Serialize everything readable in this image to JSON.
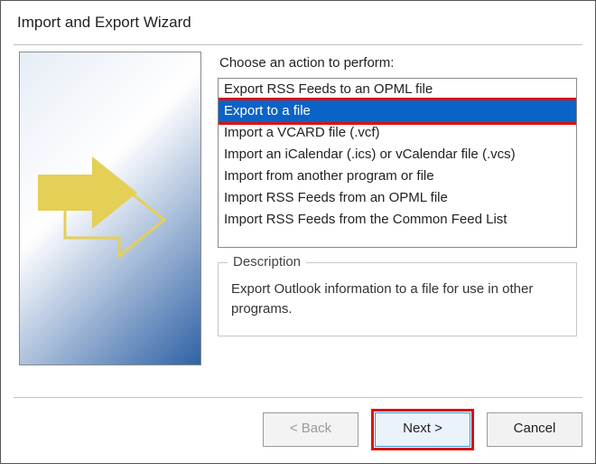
{
  "title": "Import and Export Wizard",
  "prompt": "Choose an action to perform:",
  "actions": [
    "Export RSS Feeds to an OPML file",
    "Export to a file",
    "Import a VCARD file (.vcf)",
    "Import an iCalendar (.ics) or vCalendar file (.vcs)",
    "Import from another program or file",
    "Import RSS Feeds from an OPML file",
    "Import RSS Feeds from the Common Feed List"
  ],
  "selected_index": 1,
  "highlighted_action_index": 1,
  "description": {
    "legend": "Description",
    "text": "Export Outlook information to a file for use in other programs."
  },
  "buttons": {
    "back": "< Back",
    "next": "Next >",
    "cancel": "Cancel"
  },
  "highlighted_button": "next"
}
